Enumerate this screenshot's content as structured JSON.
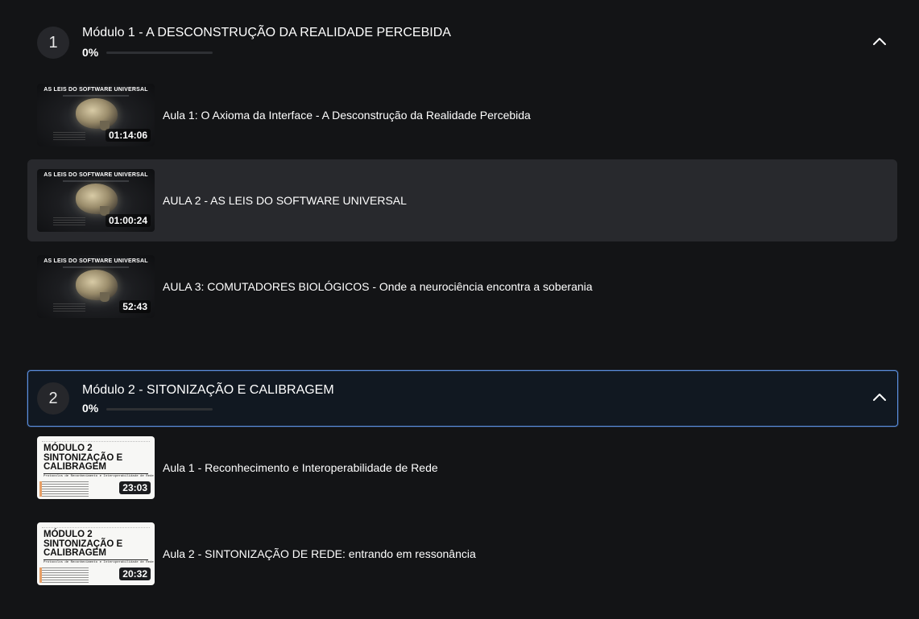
{
  "modules": [
    {
      "number": "1",
      "title": "Módulo 1 - A DESCONSTRUÇÃO DA REALIDADE PERCEBIDA",
      "progress_label": "0%",
      "progress": 0,
      "expanded": true,
      "lessons": [
        {
          "title": "Aula 1: O Axioma da Interface - A Desconstrução da Realidade Percebida",
          "duration": "01:14:06",
          "thumb_text": "AS LEIS DO SOFTWARE UNIVERSAL"
        },
        {
          "title": "AULA 2 - AS LEIS DO SOFTWARE UNIVERSAL",
          "duration": "01:00:24",
          "thumb_text": "AS LEIS DO SOFTWARE UNIVERSAL",
          "selected": true
        },
        {
          "title": "AULA 3: COMUTADORES BIOLÓGICOS - Onde a neurociência encontra a soberania",
          "duration": "52:43",
          "thumb_text": "AS LEIS DO SOFTWARE UNIVERSAL"
        }
      ]
    },
    {
      "number": "2",
      "title": "Módulo 2 - SITONIZAÇÃO E CALIBRAGEM",
      "progress_label": "0%",
      "progress": 0,
      "expanded": true,
      "active": true,
      "lessons": [
        {
          "title": "Aula 1 - Reconhecimento e Interoperabilidade de Rede",
          "duration": "23:03",
          "thumb_text": "MÓDULO 2\nSINTONIZAÇÃO E\nCALIBRAGEM",
          "thumb_sub": "Protocolos de Reconhecimento e Interoperabilidade de Rede"
        },
        {
          "title": "Aula 2 - SINTONIZAÇÃO DE REDE: entrando em ressonância",
          "duration": "20:32",
          "thumb_text": "MÓDULO 2\nSINTONIZAÇÃO E\nCALIBRAGEM",
          "thumb_sub": "Protocolos de Reconhecimento e Interoperabilidade de Rede"
        }
      ]
    }
  ],
  "icons": {
    "collapse": "chevron-up-icon"
  },
  "colors": {
    "background": "#131416",
    "accent": "#5b8fe0",
    "selected_row": "#28292d"
  }
}
